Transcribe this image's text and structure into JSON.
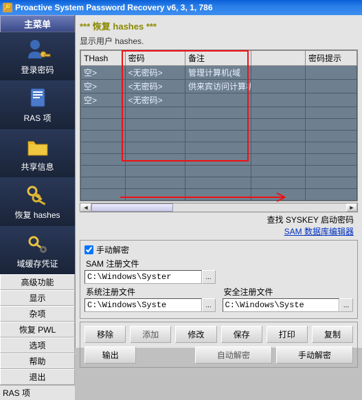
{
  "title": "Proactive System Password Recovery v6, 3, 1, 786",
  "sidebar": {
    "header": "主菜单",
    "items": [
      {
        "label": "登录密码"
      },
      {
        "label": "RAS 项"
      },
      {
        "label": "共享信息"
      },
      {
        "label": "恢复 hashes"
      },
      {
        "label": "域缓存凭证"
      }
    ],
    "buttons": [
      "高级功能",
      "显示",
      "杂项",
      "恢复 PWL",
      "选项",
      "帮助",
      "退出"
    ]
  },
  "content": {
    "heading1": "*** 恢复 hashes ***",
    "heading2": "显示用户 hashes.",
    "table": {
      "headers": [
        "THash",
        "密码",
        "备注",
        "",
        "密码提示"
      ],
      "rows": [
        [
          "空>",
          "<无密码>",
          "管理计算机(域",
          "",
          ""
        ],
        [
          "空>",
          "<无密码>",
          "供来宾访问计算机",
          "",
          ""
        ],
        [
          "空>",
          "<无密码>",
          "",
          "",
          ""
        ]
      ]
    },
    "links": {
      "find_label": "查找 SYSKEY 启动密码",
      "sam_label": "SAM 数据库编辑器"
    },
    "panel": {
      "chk_label": "手动解密",
      "sam_reg_label": "SAM 注册文件",
      "sys_reg_label": "系统注册文件",
      "safe_reg_label": "安全注册文件",
      "sam_path": "C:\\Windows\\Syster",
      "sys_path": "C:\\Windows\\Syste",
      "safe_path": "C:\\Windows\\Syste",
      "browse": "..."
    },
    "buttons_top": [
      "移除",
      "添加",
      "修改",
      "保存",
      "打印",
      "复制"
    ],
    "buttons_bottom": [
      "输出",
      "",
      "自动解密",
      "手动解密"
    ]
  },
  "footer": "RAS 项"
}
